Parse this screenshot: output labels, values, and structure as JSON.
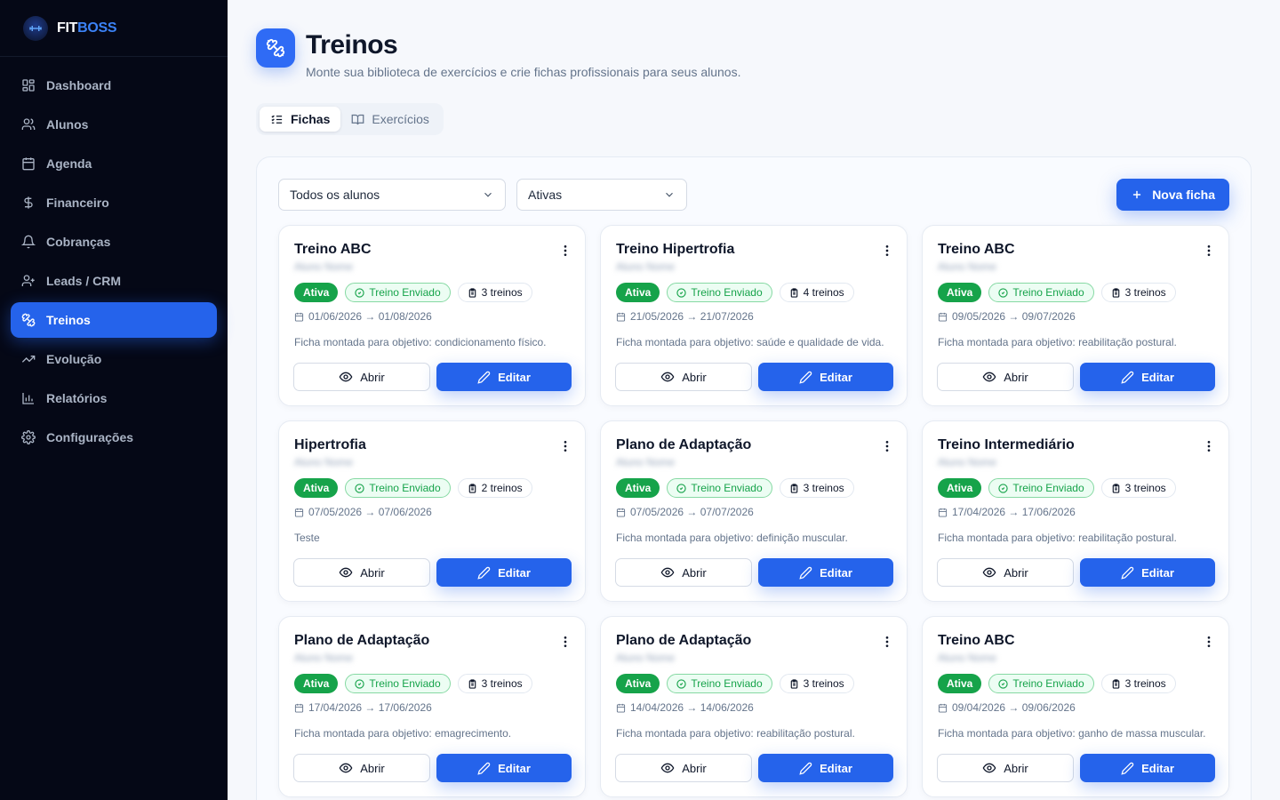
{
  "brand": {
    "name_part1": "FIT",
    "name_part2": "BOSS",
    "logo_text": "FITBOSS"
  },
  "sidebar": {
    "items": [
      {
        "label": "Dashboard",
        "icon": "grid-icon"
      },
      {
        "label": "Alunos",
        "icon": "users-icon"
      },
      {
        "label": "Agenda",
        "icon": "calendar-icon"
      },
      {
        "label": "Financeiro",
        "icon": "dollar-icon"
      },
      {
        "label": "Cobranças",
        "icon": "bell-icon"
      },
      {
        "label": "Leads / CRM",
        "icon": "user-plus-icon"
      },
      {
        "label": "Treinos",
        "icon": "dumbbell-icon",
        "active": true
      },
      {
        "label": "Evolução",
        "icon": "trending-up-icon"
      },
      {
        "label": "Relatórios",
        "icon": "bar-chart-icon"
      },
      {
        "label": "Configurações",
        "icon": "gear-icon"
      }
    ]
  },
  "header": {
    "title": "Treinos",
    "subtitle": "Monte sua biblioteca de exercícios e crie fichas profissionais para seus alunos."
  },
  "tabs": [
    {
      "label": "Fichas",
      "active": true
    },
    {
      "label": "Exercícios",
      "active": false
    }
  ],
  "filters": {
    "student": "Todos os alunos",
    "status": "Ativas"
  },
  "new_button": "Nova ficha",
  "cards": [
    {
      "title": "Treino ABC",
      "student": "Aluno Nome",
      "status": "Ativa",
      "sent": "Treino Enviado",
      "count": "3 treinos",
      "dates": "01/06/2026 → 01/08/2026",
      "desc": "Ficha montada para objetivo: condicionamento físico.",
      "open": "Abrir",
      "edit": "Editar"
    },
    {
      "title": "Treino Hipertrofia",
      "student": "Aluno Nome",
      "status": "Ativa",
      "sent": "Treino Enviado",
      "count": "4 treinos",
      "dates": "21/05/2026 → 21/07/2026",
      "desc": "Ficha montada para objetivo: saúde e qualidade de vida.",
      "open": "Abrir",
      "edit": "Editar"
    },
    {
      "title": "Treino ABC",
      "student": "Aluno Nome",
      "status": "Ativa",
      "sent": "Treino Enviado",
      "count": "3 treinos",
      "dates": "09/05/2026 → 09/07/2026",
      "desc": "Ficha montada para objetivo: reabilitação postural.",
      "open": "Abrir",
      "edit": "Editar"
    },
    {
      "title": "Hipertrofia",
      "student": "Aluno Nome",
      "status": "Ativa",
      "sent": "Treino Enviado",
      "count": "2 treinos",
      "dates": "07/05/2026 → 07/06/2026",
      "desc": "Teste",
      "open": "Abrir",
      "edit": "Editar"
    },
    {
      "title": "Plano de Adaptação",
      "student": "Aluno Nome",
      "status": "Ativa",
      "sent": "Treino Enviado",
      "count": "3 treinos",
      "dates": "07/05/2026 → 07/07/2026",
      "desc": "Ficha montada para objetivo: definição muscular.",
      "open": "Abrir",
      "edit": "Editar"
    },
    {
      "title": "Treino Intermediário",
      "student": "Aluno Nome",
      "status": "Ativa",
      "sent": "Treino Enviado",
      "count": "3 treinos",
      "dates": "17/04/2026 → 17/06/2026",
      "desc": "Ficha montada para objetivo: reabilitação postural.",
      "open": "Abrir",
      "edit": "Editar"
    },
    {
      "title": "Plano de Adaptação",
      "student": "Aluno Nome",
      "status": "Ativa",
      "sent": "Treino Enviado",
      "count": "3 treinos",
      "dates": "17/04/2026 → 17/06/2026",
      "desc": "Ficha montada para objetivo: emagrecimento.",
      "open": "Abrir",
      "edit": "Editar"
    },
    {
      "title": "Plano de Adaptação",
      "student": "Aluno Nome",
      "status": "Ativa",
      "sent": "Treino Enviado",
      "count": "3 treinos",
      "dates": "14/04/2026 → 14/06/2026",
      "desc": "Ficha montada para objetivo: reabilitação postural.",
      "open": "Abrir",
      "edit": "Editar"
    },
    {
      "title": "Treino ABC",
      "student": "Aluno Nome",
      "status": "Ativa",
      "sent": "Treino Enviado",
      "count": "3 treinos",
      "dates": "09/04/2026 → 09/06/2026",
      "desc": "Ficha montada para objetivo: ganho de massa muscular.",
      "open": "Abrir",
      "edit": "Editar"
    }
  ],
  "colors": {
    "accent": "#2563eb",
    "sidebar_bg": "#050816",
    "success": "#16a34a"
  }
}
